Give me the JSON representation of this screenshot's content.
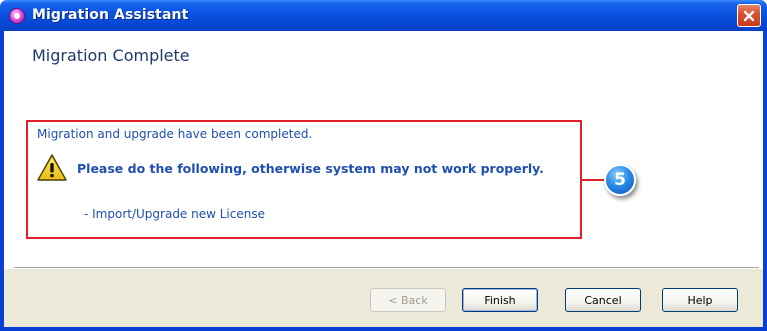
{
  "window": {
    "title": "Migration Assistant",
    "accent_color": "#0a54e3",
    "close_icon": "close-icon"
  },
  "page": {
    "header": "Migration Complete",
    "message": "Migration and upgrade have been completed.",
    "warning_icon": "warning-icon",
    "warning": "Please do the following, otherwise system may not work properly.",
    "action_item": "- Import/Upgrade new License"
  },
  "annotation": {
    "step_number": "5",
    "highlight_color": "#e0202a"
  },
  "buttons": {
    "back": "< Back",
    "finish": "Finish",
    "cancel": "Cancel",
    "help": "Help"
  }
}
